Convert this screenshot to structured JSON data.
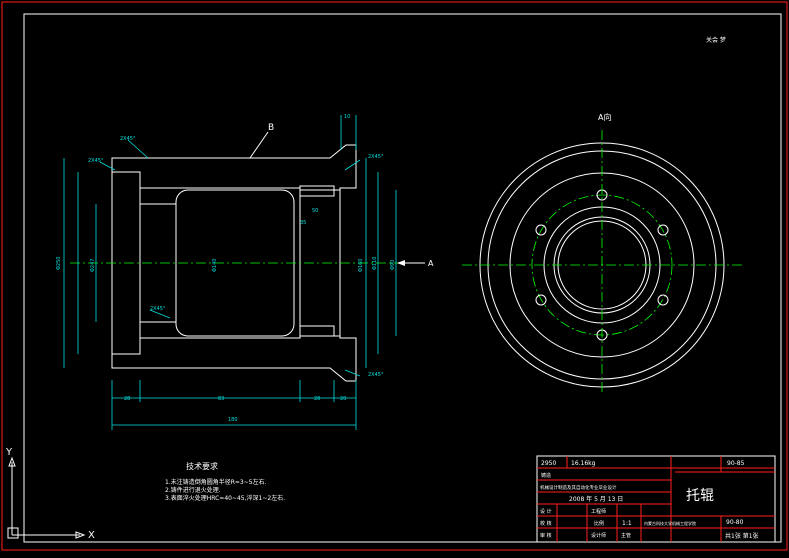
{
  "drawing": {
    "signature_mark": "关会 梦",
    "view_label": "A向",
    "section_label": "B",
    "arrow_label": "A",
    "dimensions": {
      "d_outer": "Φ250",
      "d_mid1": "Φ247",
      "d_mid2": "Φ160",
      "d_shaft": "Φ140",
      "d_inner1": "Φ110",
      "d_inner2": "Φ90",
      "d_inner3": "Φ70",
      "len_28": "28",
      "len_83": "83",
      "len_28b": "28",
      "len_20": "20",
      "len_total": "180",
      "len_top": "10",
      "len_50": "50",
      "len_35": "35",
      "chamfer": "2X45°"
    },
    "tech_requirements": {
      "title": "技术要求",
      "items": [
        "1.未注铸造倒角圆角半径R=3~5左右.",
        "2.铸件进行退火处理.",
        "3.表面淬火处理HRC=40~45,淬深1~2左右."
      ]
    }
  },
  "title_block": {
    "drawing_number": "2950",
    "weight": "16.16kg",
    "material": "铸造",
    "scale_label": "比例",
    "scale_value": "1:1",
    "part_no": "90-85",
    "part_no2": "90-80",
    "design_school": "机械设计制造及其自动化专业毕业设计",
    "date": "2008 年 5 月 13 日",
    "part_name": "托辊",
    "sheet_text": "共1张 第1张",
    "university": "内蒙古科技大学机械工程学院",
    "rows": [
      "设 计",
      "校 核",
      "审 核",
      "标 准",
      "工 艺",
      "批 准"
    ],
    "roles": [
      "工程师",
      "设计师",
      "主管"
    ]
  },
  "ucs": {
    "y_label": "Y",
    "x_label": "X"
  }
}
